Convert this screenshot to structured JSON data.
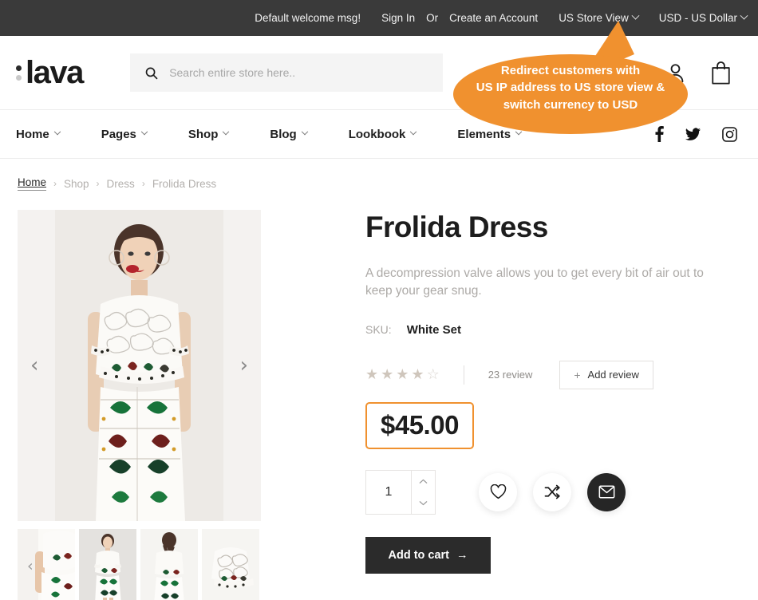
{
  "topbar": {
    "welcome_msg": "Default welcome msg!",
    "sign_in": "Sign In",
    "or": "Or",
    "create_account": "Create an Account",
    "store_view": "US Store View",
    "currency": "USD - US Dollar"
  },
  "header": {
    "logo_text": "lava",
    "search_placeholder": "Search entire store here..",
    "search_value": "",
    "account_icon": "user-icon",
    "cart_icon": "shopping-bag-icon"
  },
  "nav": {
    "items": [
      {
        "label": "Home"
      },
      {
        "label": "Pages"
      },
      {
        "label": "Shop"
      },
      {
        "label": "Blog"
      },
      {
        "label": "Lookbook"
      },
      {
        "label": "Elements"
      }
    ],
    "social": [
      "facebook-icon",
      "twitter-icon",
      "instagram-icon"
    ]
  },
  "breadcrumb": {
    "items": [
      "Home",
      "Shop",
      "Dress",
      "Frolida Dress"
    ],
    "separator": "›"
  },
  "callout": {
    "line1": "Redirect customers with",
    "line2": "US IP address to US store view &",
    "line3": "switch currency to USD",
    "color": "#f0912f"
  },
  "gallery": {
    "prev_arrow": "‹",
    "next_arrow": "›",
    "thumb_prev_arrow": "‹",
    "thumb_count": 4
  },
  "product": {
    "title": "Frolida Dress",
    "description": "A decompression valve allows you to get every bit of air out to keep your gear  snug.",
    "sku_label": "SKU:",
    "sku_value": "White Set",
    "rating": {
      "filled": 4,
      "total": 5,
      "star_filled": "★",
      "star_empty": "☆"
    },
    "review_count": "23 review",
    "add_review_label": "Add review",
    "add_review_plus": "+",
    "price": "$45.00",
    "price_border_color": "#f0912f",
    "quantity": "1",
    "qty_up": "⌃",
    "qty_down": "⌄",
    "wishlist_icon": "heart-icon",
    "compare_icon": "shuffle-icon",
    "email_icon": "envelope-icon",
    "add_to_cart_label": "Add to cart",
    "add_to_cart_arrow": "→"
  }
}
